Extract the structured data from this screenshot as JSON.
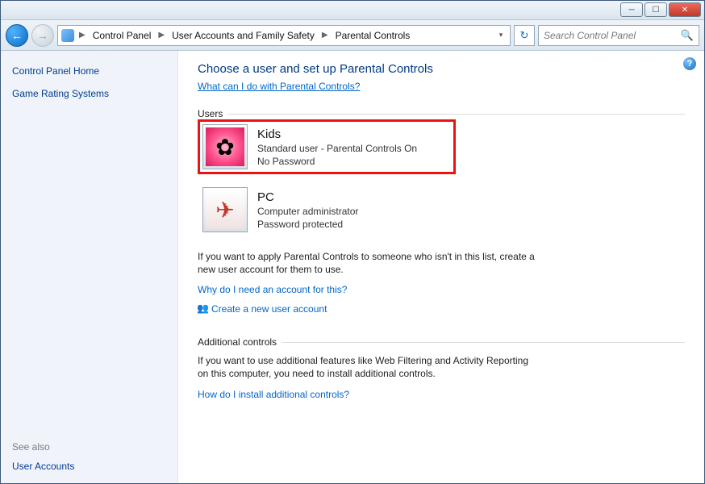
{
  "titlebar": {
    "min_tip": "Minimize",
    "max_tip": "Maximize",
    "close_tip": "Close"
  },
  "address": {
    "back_tip": "Back",
    "forward_tip": "Forward",
    "refresh_tip": "Refresh",
    "crumbs": [
      "Control Panel",
      "User Accounts and Family Safety",
      "Parental Controls"
    ],
    "search_placeholder": "Search Control Panel"
  },
  "sidebar": {
    "top_links": [
      "Control Panel Home",
      "Game Rating Systems"
    ],
    "see_also_label": "See also",
    "bottom_links": [
      "User Accounts"
    ]
  },
  "main": {
    "title": "Choose a user and set up Parental Controls",
    "help_link": "What can I do with Parental Controls?",
    "users_label": "Users",
    "users": [
      {
        "name": "Kids",
        "line1": "Standard user - Parental Controls On",
        "line2": "No Password",
        "highlight": true,
        "avatar": "kids"
      },
      {
        "name": "PC",
        "line1": "Computer administrator",
        "line2": "Password protected",
        "highlight": false,
        "avatar": "pc"
      }
    ],
    "apply_text": "If you want to apply Parental Controls to someone who isn't in this list, create a new user account for them to use.",
    "why_link": "Why do I need an account for this?",
    "create_link": "Create a new user account",
    "additional_label": "Additional controls",
    "additional_text": "If you want to use additional features like Web Filtering and Activity Reporting on this computer, you need to install additional controls.",
    "install_link": "How do I install additional controls?"
  }
}
